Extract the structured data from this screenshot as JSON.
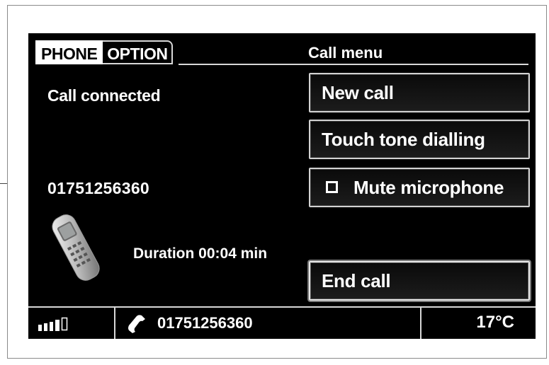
{
  "tabs": [
    {
      "label": "PHONE",
      "active": true
    },
    {
      "label": "OPTION",
      "active": false
    }
  ],
  "call_menu": {
    "title": "Call menu",
    "buttons": {
      "new_call": "New call",
      "touch_tone": "Touch tone dialling",
      "mute": {
        "label": "Mute microphone",
        "checked": false
      },
      "end_call": "End call"
    }
  },
  "call_info": {
    "status": "Call connected",
    "number": "01751256360",
    "duration": "Duration 00:04 min"
  },
  "status_bar": {
    "signal_bars_filled": 4,
    "signal_bars_total": 5,
    "number": "01751256360",
    "temperature": "17°C"
  },
  "colors": {
    "screen_background": "#000000",
    "text": "#ffffff",
    "border": "#d8d8d8"
  }
}
